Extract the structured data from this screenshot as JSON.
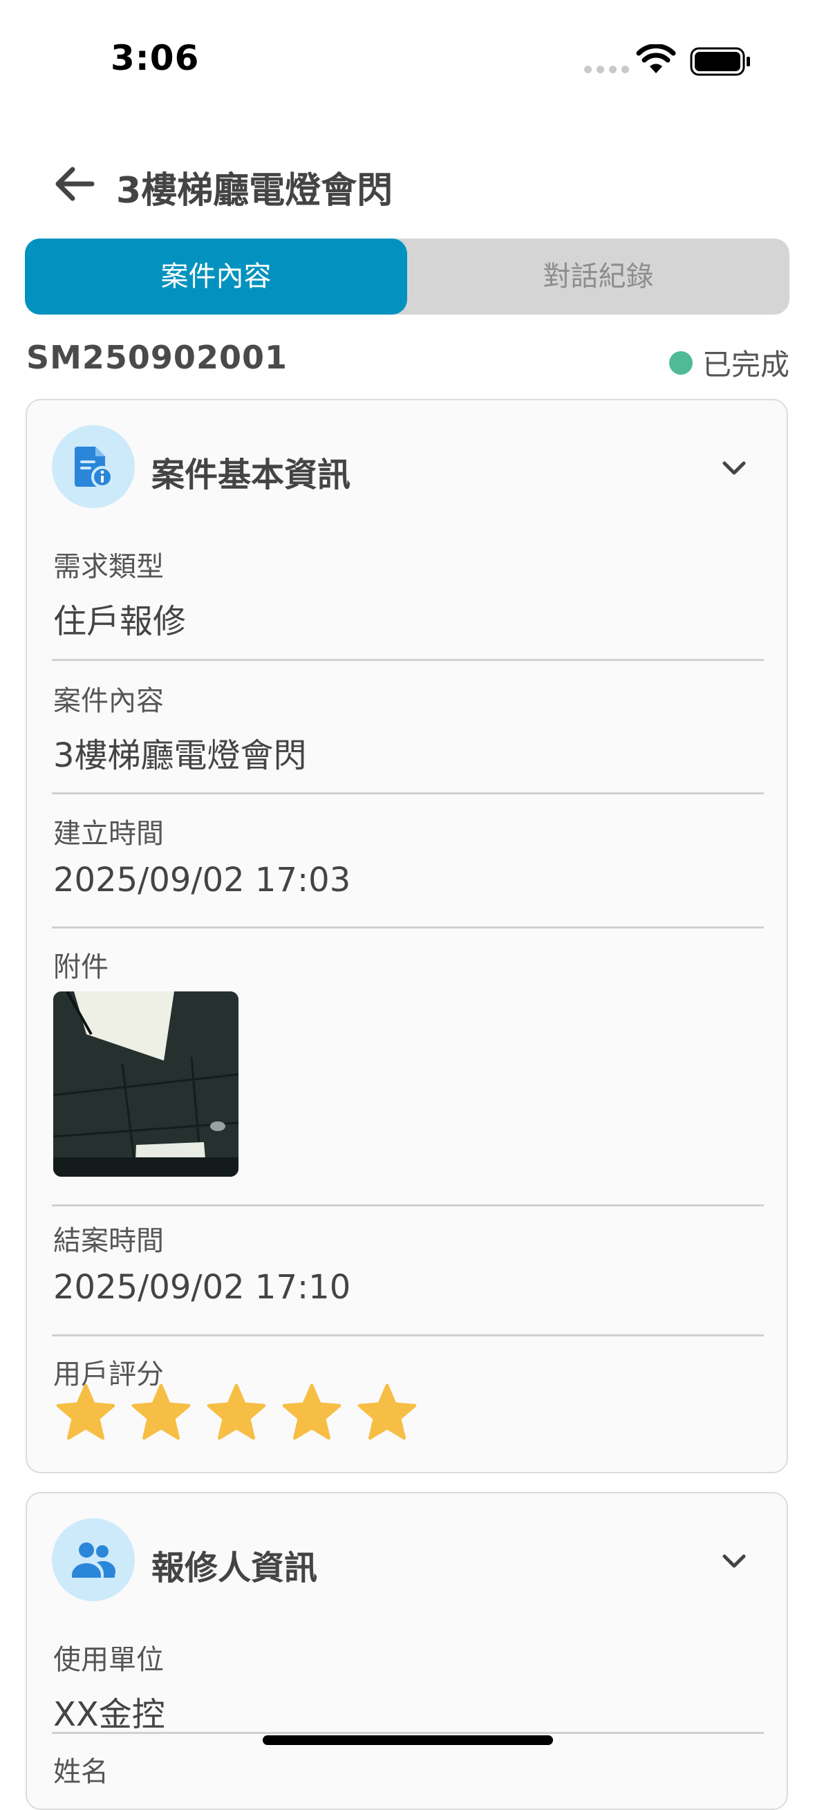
{
  "status_bar": {
    "time": "3:06"
  },
  "header": {
    "title": "3樓梯廳電燈會閃"
  },
  "tabs": [
    {
      "label": "案件內容",
      "active": true
    },
    {
      "label": "對話紀錄",
      "active": false
    }
  ],
  "case": {
    "number": "SM250902001",
    "status": "已完成",
    "status_color": "#4fba96"
  },
  "basic_info": {
    "title": "案件基本資訊",
    "fields": [
      {
        "label": "需求類型",
        "value": "住戶報修"
      },
      {
        "label": "案件內容",
        "value": "3樓梯廳電燈會閃"
      },
      {
        "label": "建立時間",
        "value": "2025/09/02 17:03"
      }
    ],
    "attachment_label": "附件",
    "close_time_label": "結案時間",
    "close_time_value": "2025/09/02 17:10",
    "rating_label": "用戶評分",
    "rating": 5,
    "rating_max": 5
  },
  "reporter_info": {
    "title": "報修人資訊",
    "fields": [
      {
        "label": "使用單位",
        "value": "XX金控"
      },
      {
        "label": "姓名",
        "value": ""
      }
    ]
  },
  "colors": {
    "accent": "#0392bf",
    "star": "#f6be44",
    "icon_bg": "#cdeafb",
    "icon_fg": "#2a86d8"
  }
}
